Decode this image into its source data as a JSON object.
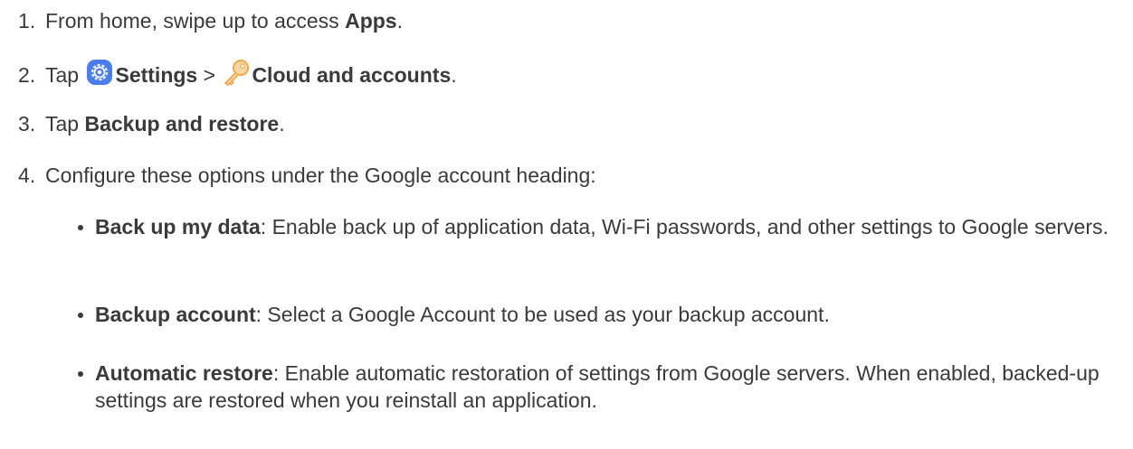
{
  "steps": [
    {
      "num": "1.",
      "pre": "From home, swipe up to access ",
      "bold": "Apps",
      "post": "."
    },
    {
      "num": "2.",
      "pre": "Tap ",
      "icon1": "settings-icon",
      "bold1": "Settings",
      "mid": " > ",
      "icon2": "key-icon",
      "bold2": "Cloud and accounts",
      "post": "."
    },
    {
      "num": "3.",
      "pre": "Tap ",
      "bold": "Backup and restore",
      "post": "."
    },
    {
      "num": "4.",
      "text": "Configure these options under the Google account heading:"
    }
  ],
  "options": [
    {
      "bold": "Back up my data",
      "text": ": Enable back up of application data, Wi-Fi passwords, and other settings to Google servers."
    },
    {
      "bold": "Backup account",
      "text": ": Select a Google Account to be used as your backup account."
    },
    {
      "bold": "Automatic restore",
      "text": ": Enable automatic restoration of settings from Google servers. When enabled, backed-up settings are restored when you reinstall an application."
    }
  ],
  "colors": {
    "text": "#3a3a3a",
    "settings_icon": "#4a7ef0",
    "key_icon": "#f4a64a"
  }
}
